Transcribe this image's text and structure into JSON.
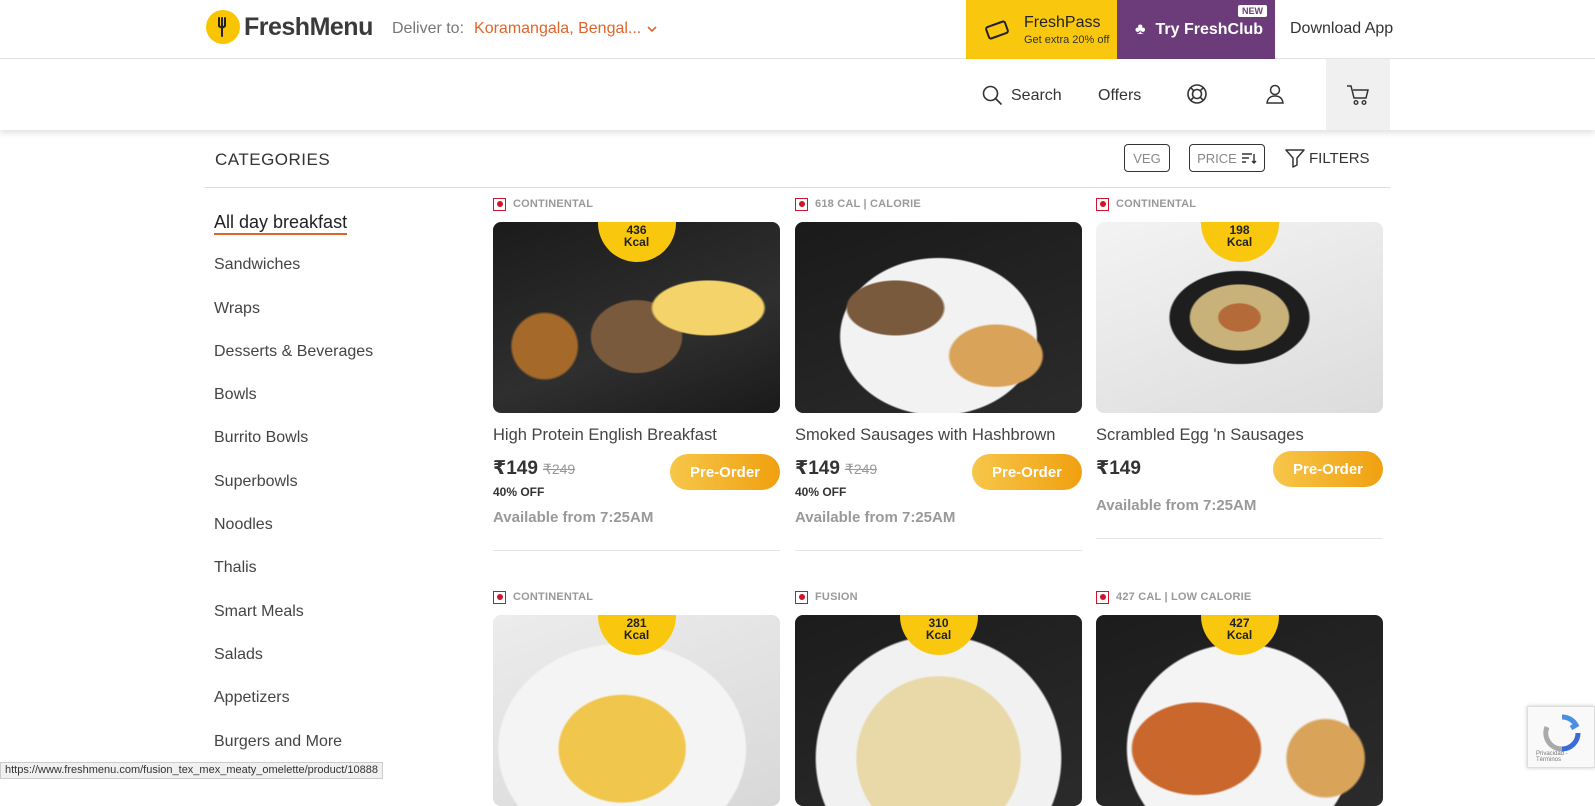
{
  "header": {
    "logo_text": "FreshMenu",
    "deliver_label": "Deliver to:",
    "deliver_location": "Koramangala, Bengal...",
    "freshpass_title": "FreshPass",
    "freshpass_sub": "Get extra 20% off",
    "freshclub_label": "Try FreshClub",
    "freshclub_badge": "NEW",
    "download_label": "Download App"
  },
  "nav": {
    "search_label": "Search",
    "offers_label": "Offers"
  },
  "categories_bar": {
    "title": "CATEGORIES",
    "veg_label": "VEG",
    "price_label": "PRICE",
    "filters_label": "FILTERS"
  },
  "sidebar": {
    "items": [
      {
        "label": "All day breakfast"
      },
      {
        "label": "Sandwiches"
      },
      {
        "label": "Wraps"
      },
      {
        "label": "Desserts & Beverages"
      },
      {
        "label": "Bowls"
      },
      {
        "label": "Burrito Bowls"
      },
      {
        "label": "Superbowls"
      },
      {
        "label": "Noodles"
      },
      {
        "label": "Thalis"
      },
      {
        "label": "Smart Meals"
      },
      {
        "label": "Salads"
      },
      {
        "label": "Appetizers"
      },
      {
        "label": "Burgers and More"
      }
    ]
  },
  "products": [
    {
      "tag": "CONTINENTAL",
      "kcal_value": "436",
      "kcal_unit": "Kcal",
      "name": "High Protein English Breakfast",
      "price": "₹149",
      "mrp": "₹249",
      "discount": "40% OFF",
      "cta": "Pre-Order",
      "availability": "Available from 7:25AM"
    },
    {
      "tag": "618 CAL | CALORIE",
      "kcal_value": "",
      "kcal_unit": "",
      "name": "Smoked Sausages with Hashbrown",
      "price": "₹149",
      "mrp": "₹249",
      "discount": "40% OFF",
      "cta": "Pre-Order",
      "availability": "Available from 7:25AM"
    },
    {
      "tag": "CONTINENTAL",
      "kcal_value": "198",
      "kcal_unit": "Kcal",
      "name": "Scrambled Egg 'n Sausages",
      "price": "₹149",
      "mrp": "",
      "discount": "",
      "cta": "Pre-Order",
      "availability": "Available from 7:25AM"
    },
    {
      "tag": "CONTINENTAL",
      "kcal_value": "281",
      "kcal_unit": "Kcal"
    },
    {
      "tag": "FUSION",
      "kcal_value": "310",
      "kcal_unit": "Kcal"
    },
    {
      "tag": "427 CAL | LOW CALORIE",
      "kcal_value": "427",
      "kcal_unit": "Kcal"
    }
  ],
  "statusbar": {
    "url": "https://www.freshmenu.com/fusion_tex_mex_meaty_omelette/product/10888"
  },
  "recaptcha": {
    "text": "Privacidad - Términos"
  },
  "colors": {
    "accent": "#e0652a",
    "freshpass_bg": "#f9c80e",
    "freshclub_bg": "#6b3b7a",
    "preorder": "#f0a010",
    "nonveg": "#d0142c"
  }
}
